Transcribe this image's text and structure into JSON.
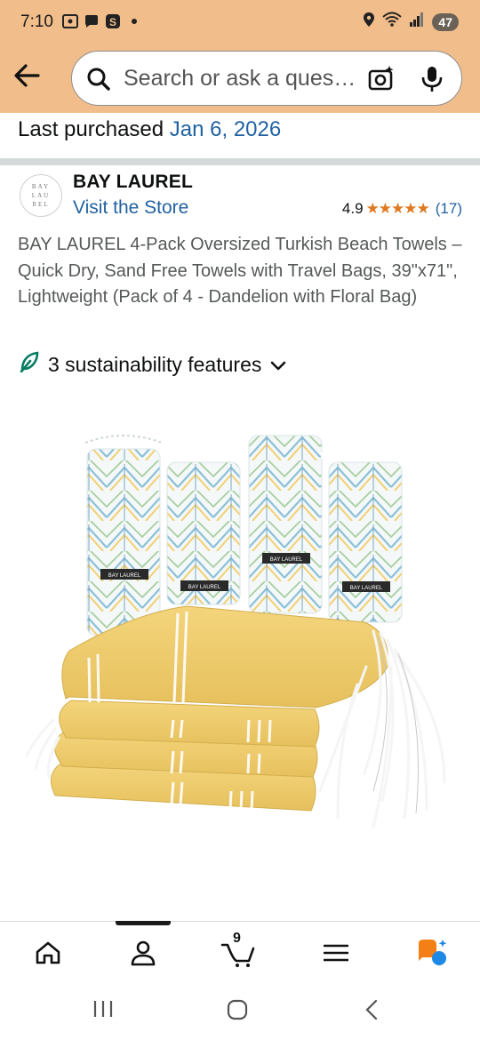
{
  "status_bar": {
    "time": "7:10",
    "battery": "47"
  },
  "search": {
    "placeholder": "Search or ask a ques…"
  },
  "last_purchased": {
    "label": "Last purchased",
    "date": "Jan 6, 2026"
  },
  "store": {
    "logo_text": "BAY LAU REL",
    "brand": "BAY LAUREL",
    "link": "Visit the Store",
    "rating": "4.9",
    "stars": "★★★★★",
    "review_count": "(17)"
  },
  "product": {
    "title": "BAY LAUREL 4-Pack Oversized Turkish Beach Towels – Quick Dry, Sand Free Towels with Travel Bags, 39\"x71\", Lightweight (Pack of 4 - Dandelion with Floral Bag)",
    "sustainability": "3 sustainability features",
    "bag_label": "BAY LAUREL"
  },
  "tab_bar": {
    "items": [
      "home-icon",
      "account-icon",
      "cart-icon",
      "menu-icon",
      "rufus-icon"
    ],
    "cart_count": "9"
  },
  "colors": {
    "header": "#f1bd8a",
    "link": "#2162a1",
    "star": "#de7921",
    "towel": "#f0cc6a"
  }
}
